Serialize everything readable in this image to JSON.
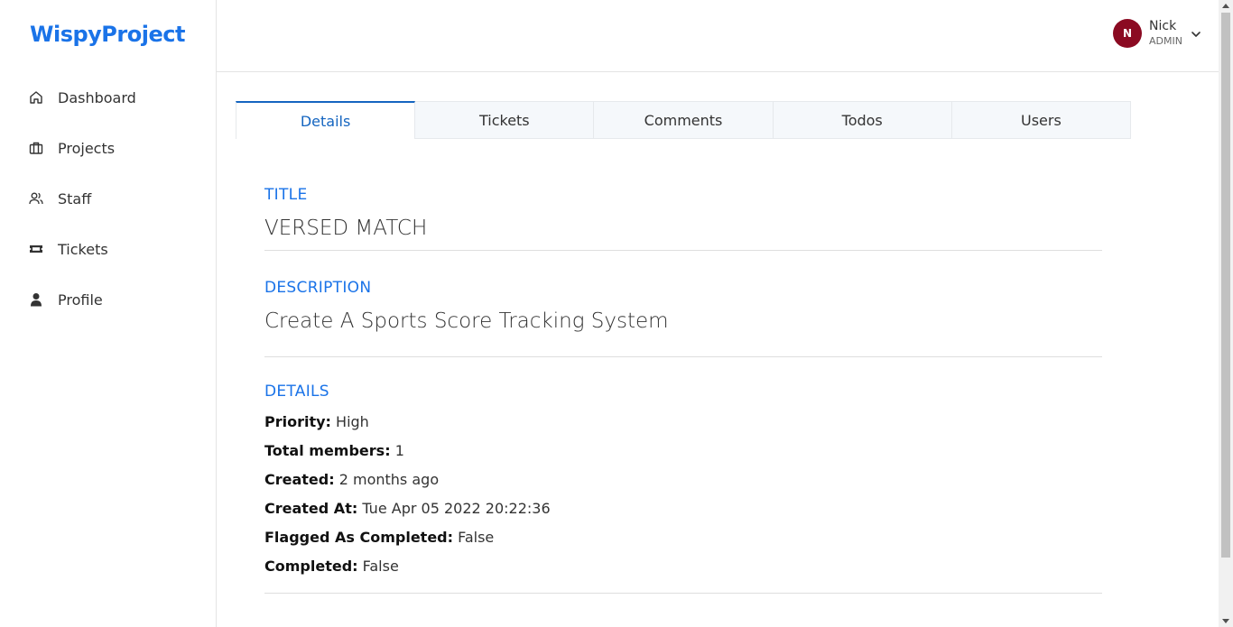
{
  "brand": "WispyProject",
  "sidebar": {
    "items": [
      {
        "label": "Dashboard",
        "icon": "home-icon"
      },
      {
        "label": "Projects",
        "icon": "briefcase-icon"
      },
      {
        "label": "Staff",
        "icon": "users-icon"
      },
      {
        "label": "Tickets",
        "icon": "ticket-icon"
      },
      {
        "label": "Profile",
        "icon": "user-icon"
      }
    ]
  },
  "user": {
    "initial": "N",
    "name": "Nick",
    "role": "ADMIN",
    "avatar_color": "#8b0a22"
  },
  "tabs": [
    {
      "label": "Details",
      "active": true
    },
    {
      "label": "Tickets"
    },
    {
      "label": "Comments"
    },
    {
      "label": "Todos"
    },
    {
      "label": "Users"
    }
  ],
  "project": {
    "title_label": "TITLE",
    "title": "VERSED MATCH",
    "description_label": "DESCRIPTION",
    "description": "Create A Sports Score Tracking System",
    "details_label": "DETAILS",
    "details": [
      {
        "key": "Priority:",
        "value": "High"
      },
      {
        "key": "Total members:",
        "value": "1"
      },
      {
        "key": "Created:",
        "value": "2 months ago"
      },
      {
        "key": "Created At:",
        "value": "Tue Apr 05 2022 20:22:36"
      },
      {
        "key": "Flagged As Completed:",
        "value": "False"
      },
      {
        "key": "Completed:",
        "value": "False"
      }
    ]
  },
  "colors": {
    "accent": "#1a73e8",
    "tab_active": "#1565c0"
  }
}
